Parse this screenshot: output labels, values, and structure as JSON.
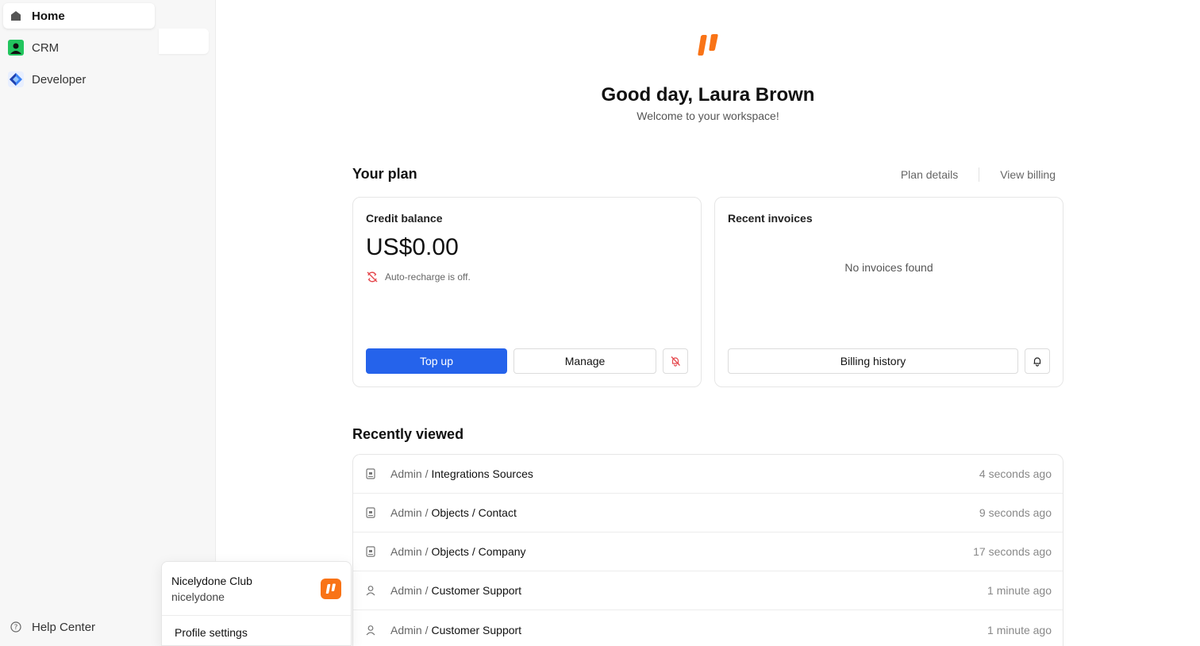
{
  "rail": {
    "items": [
      {
        "label": "Home",
        "icon": "home-icon"
      },
      {
        "label": "CRM",
        "icon": "crm-icon"
      },
      {
        "label": "Developer",
        "icon": "developer-icon"
      }
    ],
    "help_label": "Help Center"
  },
  "header": {
    "greeting": "Good day, Laura Brown",
    "welcome": "Welcome to your workspace!"
  },
  "plan": {
    "title": "Your plan",
    "plan_details": "Plan details",
    "view_billing": "View billing",
    "credit": {
      "label": "Credit balance",
      "balance": "US$0.00",
      "recharge_status": "Auto-recharge is off.",
      "top_up": "Top up",
      "manage": "Manage"
    },
    "invoices": {
      "label": "Recent invoices",
      "empty": "No invoices found",
      "billing_history": "Billing history"
    }
  },
  "recent": {
    "title": "Recently viewed",
    "items": [
      {
        "prefix": "Admin /",
        "name": "Integrations Sources",
        "time": "4 seconds ago",
        "icon": "page-icon"
      },
      {
        "prefix": "Admin /",
        "name": "Objects / Contact",
        "time": "9 seconds ago",
        "icon": "page-icon"
      },
      {
        "prefix": "Admin /",
        "name": "Objects / Company",
        "time": "17 seconds ago",
        "icon": "page-icon"
      },
      {
        "prefix": "Admin /",
        "name": "Customer Support",
        "time": "1 minute ago",
        "icon": "user-icon"
      },
      {
        "prefix": "Admin /",
        "name": "Customer Support",
        "time": "1 minute ago",
        "icon": "user-icon"
      }
    ]
  },
  "popover": {
    "org_name": "Nicelydone Club",
    "username": "nicelydone",
    "profile_settings": "Profile settings"
  },
  "colors": {
    "accent": "#2563eb",
    "brand": "#f97316",
    "danger": "#e5484d"
  }
}
